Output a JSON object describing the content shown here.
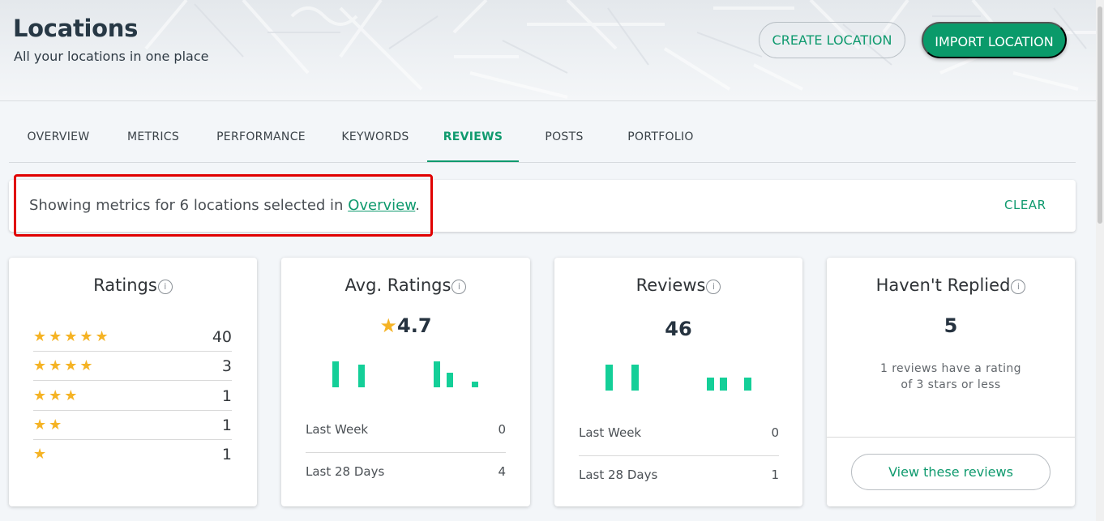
{
  "header": {
    "title": "Locations",
    "subtitle": "All your locations in one place",
    "create_label": "CREATE LOCATION",
    "import_label": "IMPORT LOCATION"
  },
  "tabs": [
    {
      "label": "OVERVIEW",
      "active": false
    },
    {
      "label": "METRICS",
      "active": false
    },
    {
      "label": "PERFORMANCE",
      "active": false
    },
    {
      "label": "KEYWORDS",
      "active": false
    },
    {
      "label": "REVIEWS",
      "active": true
    },
    {
      "label": "POSTS",
      "active": false
    },
    {
      "label": "PORTFOLIO",
      "active": false
    }
  ],
  "banner": {
    "text_before": "Showing metrics for 6 locations selected in ",
    "link": "Overview",
    "text_after": ".",
    "clear_label": "CLEAR"
  },
  "ratings_card": {
    "title": "Ratings",
    "rows": [
      {
        "stars": "★★★★★",
        "count": "40"
      },
      {
        "stars": "★★★★",
        "count": "3"
      },
      {
        "stars": "★★★",
        "count": "1"
      },
      {
        "stars": "★★",
        "count": "1"
      },
      {
        "stars": "★",
        "count": "1"
      }
    ]
  },
  "avg_card": {
    "title": "Avg. Ratings",
    "star": "★",
    "value": "4.7",
    "last_week_label": "Last Week",
    "last_week_value": "0",
    "last_28_label": "Last 28 Days",
    "last_28_value": "4"
  },
  "reviews_card": {
    "title": "Reviews",
    "value": "46",
    "last_week_label": "Last Week",
    "last_week_value": "0",
    "last_28_label": "Last 28 Days",
    "last_28_value": "1"
  },
  "replied_card": {
    "title": "Haven't Replied",
    "value": "5",
    "note": "1 reviews have a rating of 3 stars or less",
    "button_label": "View these reviews"
  },
  "colors": {
    "accent": "#0f9a6e",
    "bar": "#14cf98",
    "star": "#f5b324",
    "highlight": "#e00000"
  },
  "icons": {
    "info": "info-icon",
    "star": "star-icon"
  }
}
